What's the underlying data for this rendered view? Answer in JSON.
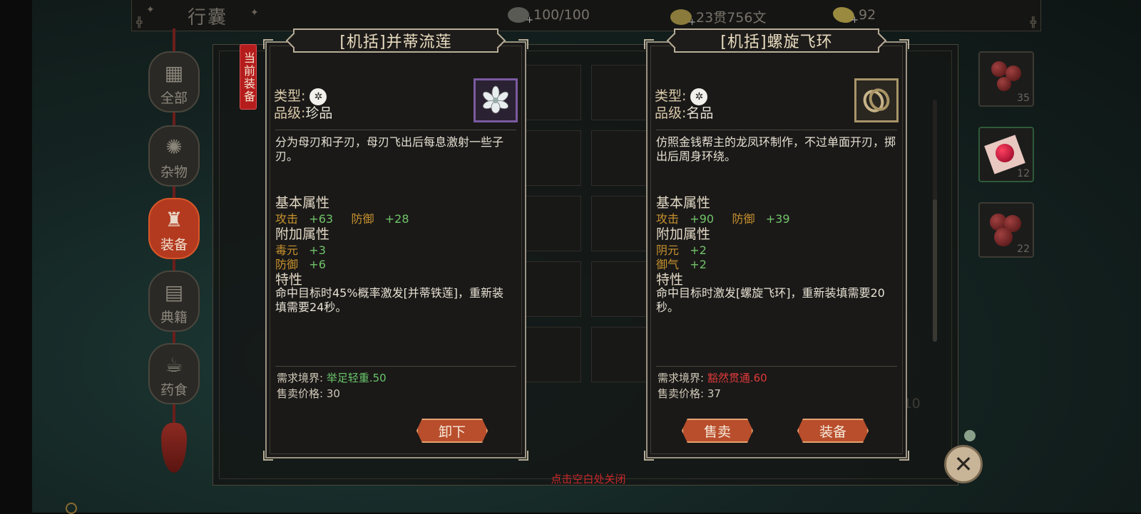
{
  "header": {
    "bag_title": "行囊",
    "stamina": "100/100",
    "money": "23贯756文",
    "gold": "92"
  },
  "tabs": [
    {
      "label": "全部",
      "icon": "grid-icon"
    },
    {
      "label": "杂物",
      "icon": "fan-icon"
    },
    {
      "label": "装备",
      "icon": "armor-icon"
    },
    {
      "label": "典籍",
      "icon": "book-icon"
    },
    {
      "label": "药食",
      "icon": "food-icon"
    }
  ],
  "active_tab": "装备",
  "inventory": {
    "capacity": "89/10",
    "side_items": [
      {
        "name": "berries",
        "count": "35"
      },
      {
        "name": "red-pill",
        "count": "12"
      },
      {
        "name": "fruit",
        "count": "22"
      }
    ]
  },
  "equipped_tag": "当前装备",
  "left_card": {
    "title": "[机括]并蒂流莲",
    "type_label": "类型",
    "quality_label": "品级",
    "quality": "珍品",
    "description": "分为母刃和子刃，母刃飞出后每息激射一些子刃。",
    "basic_title": "基本属性",
    "basic_attrs": [
      {
        "name": "攻击",
        "value": "+63"
      },
      {
        "name": "防御",
        "value": "+28"
      }
    ],
    "extra_title": "附加属性",
    "extra_attrs": [
      {
        "name": "毒元",
        "value": "+3"
      },
      {
        "name": "防御",
        "value": "+6"
      }
    ],
    "trait_title": "特性",
    "trait_text": "命中目标时45%概率激发[并蒂铁莲]，重新装填需要24秒。",
    "req_label": "需求境界:",
    "req_value": "举足轻重.50",
    "price_label": "售卖价格:",
    "price_value": "30",
    "buttons": [
      "卸下"
    ]
  },
  "right_card": {
    "title": "[机括]螺旋飞环",
    "type_label": "类型",
    "quality_label": "品级",
    "quality": "名品",
    "description": "仿照金钱帮主的龙凤环制作，不过单面开刃，掷出后周身环绕。",
    "basic_title": "基本属性",
    "basic_attrs": [
      {
        "name": "攻击",
        "value": "+90"
      },
      {
        "name": "防御",
        "value": "+39"
      }
    ],
    "extra_title": "附加属性",
    "extra_attrs": [
      {
        "name": "阴元",
        "value": "+2"
      },
      {
        "name": "御气",
        "value": "+2"
      }
    ],
    "trait_title": "特性",
    "trait_text": "命中目标时激发[螺旋飞环]，重新装填需要20秒。",
    "req_label": "需求境界:",
    "req_value": "豁然贯通.60",
    "price_label": "售卖价格:",
    "price_value": "37",
    "buttons": [
      "售卖",
      "装备"
    ]
  },
  "close_hint": "点击空白处关闭",
  "colors": {
    "attr_name": "#c8922e",
    "attr_value": "#72c36a",
    "req_ok": "#6ac46a",
    "req_fail": "#e03a3a",
    "button": "#b94e2c",
    "active_tab": "#b33a1f"
  }
}
